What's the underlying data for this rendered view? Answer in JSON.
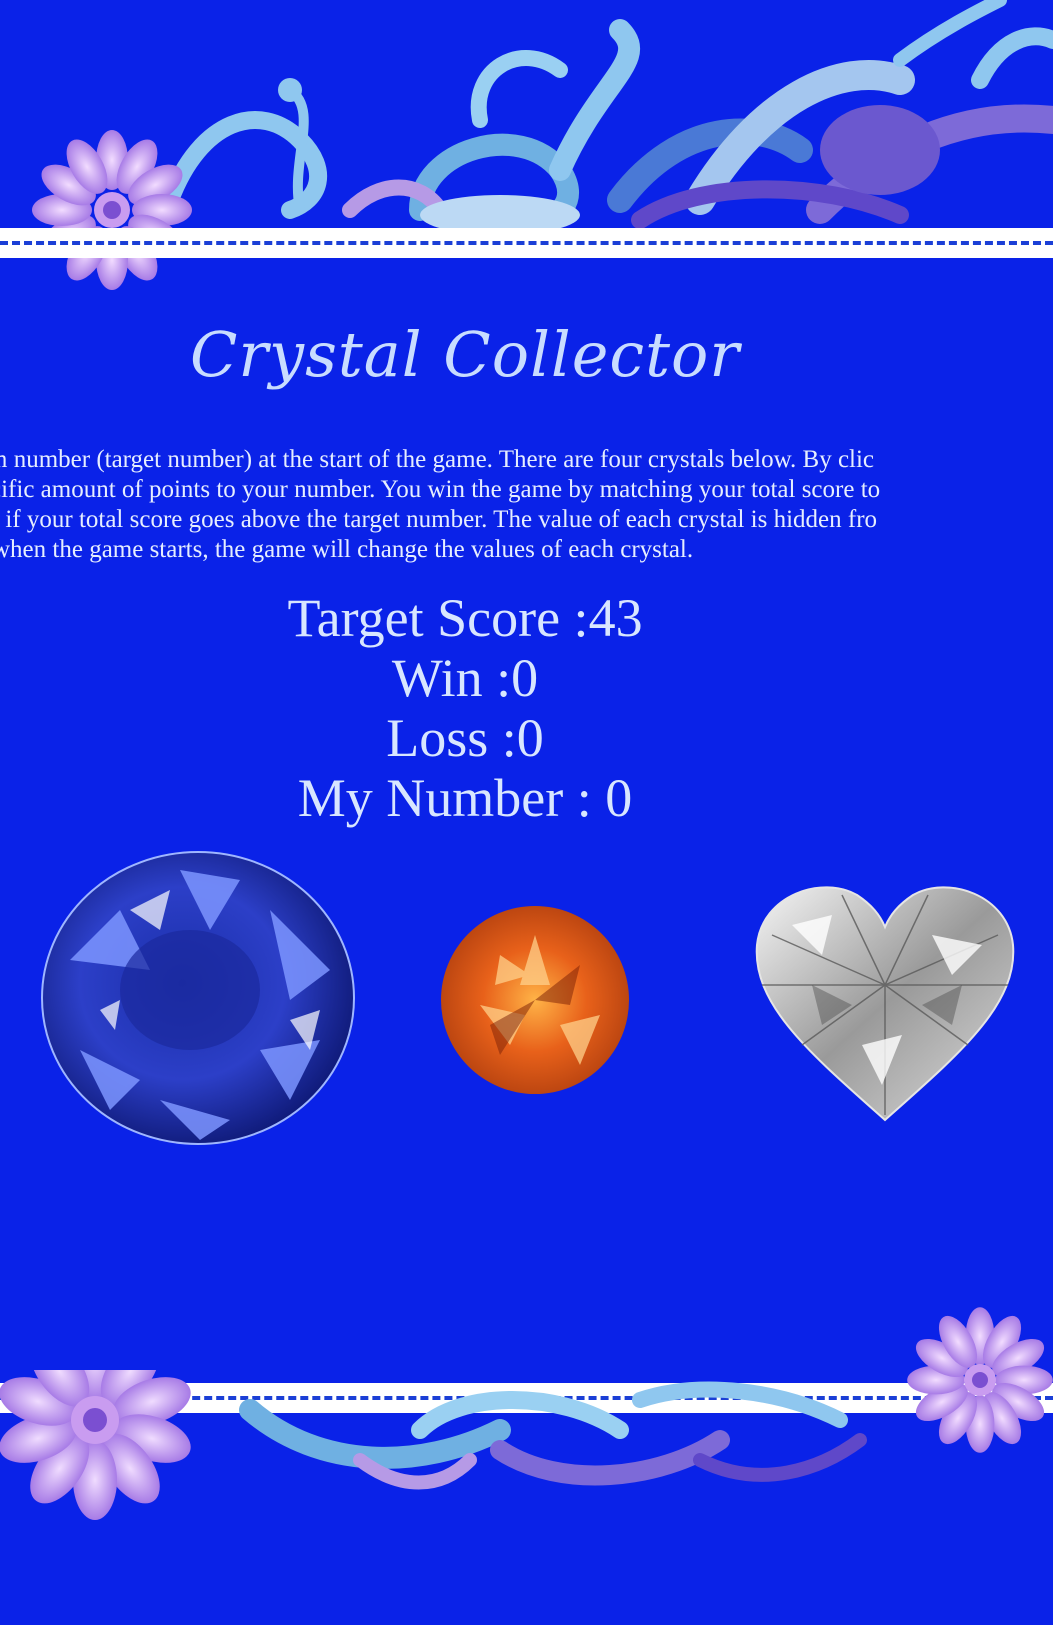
{
  "header": {
    "title": "Crystal Collector"
  },
  "instructions": {
    "lines": [
      "m number (target number) at the start of the game. There are four crystals below. By clic",
      "cific amount of points to your number. You win the game by matching your total score to",
      "e if your total score goes above the target number. The value of each crystal is hidden fro",
      " when the game starts, the game will change the values of each crystal."
    ]
  },
  "stats": {
    "target_label": "Target Score :",
    "target_value": "43",
    "win_label": "Win :",
    "win_value": "0",
    "loss_label": "Loss :",
    "loss_value": "0",
    "number_label": "My Number : ",
    "number_value": "0"
  },
  "colors": {
    "background": "#0a22e8",
    "text": "#d8e6ff",
    "band": "#ffffff",
    "stitch": "#1b3fd6"
  },
  "crystals": [
    {
      "name": "blue-sapphire-crystal",
      "icon": "oval-gem"
    },
    {
      "name": "orange-crystal",
      "icon": "round-gem"
    },
    {
      "name": "heart-diamond-crystal",
      "icon": "heart-gem"
    }
  ]
}
